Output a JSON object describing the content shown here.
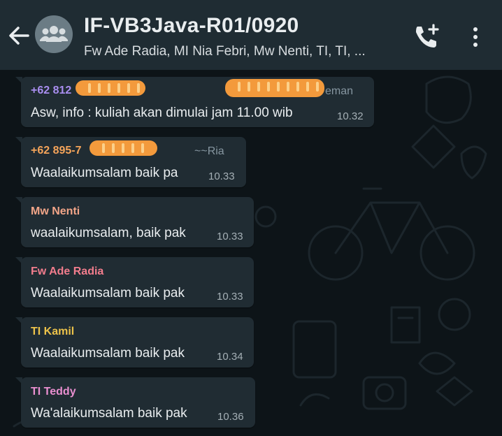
{
  "header": {
    "title": "IF-VB3Java-R01/0920",
    "subtitle": "Fw Ade Radia, MI Nia Febri, Mw Nenti, TI, TI, ...",
    "back_icon": "arrow-left-icon",
    "avatar_icon": "group-avatar-icon",
    "call_icon": "add-call-icon",
    "menu_icon": "more-vertical-icon"
  },
  "messages": [
    {
      "sender": "+62 812",
      "alias": "eman",
      "text": "Asw, info : kuliah akan dimulai jam 11.00 wib",
      "time": "10.32",
      "sender_color": "#a98ef0"
    },
    {
      "sender": "+62 895-7",
      "alias": "~~Ria",
      "text": "Waalaikumsalam baik pa",
      "time": "10.33",
      "sender_color": "#f4a45a"
    },
    {
      "sender": "Mw Nenti",
      "text": "waalaikumsalam, baik pak",
      "time": "10.33",
      "sender_color": "#f2a588"
    },
    {
      "sender": "Fw Ade Radia",
      "text": "Waalaikumsalam baik pak",
      "time": "10.33",
      "sender_color": "#f27d8d"
    },
    {
      "sender": "TI Kamil",
      "text": "Waalaikumsalam baik pak",
      "time": "10.34",
      "sender_color": "#ecc24a"
    },
    {
      "sender": "TI Teddy",
      "text": "Wa'alaikumsalam baik pak",
      "time": "10.36",
      "sender_color": "#e98fd0"
    }
  ],
  "colors": {
    "header_bg": "#1f2c33",
    "bubble_bg": "#202c33",
    "chat_bg": "#0d1418",
    "redaction": "#f39a3c"
  }
}
